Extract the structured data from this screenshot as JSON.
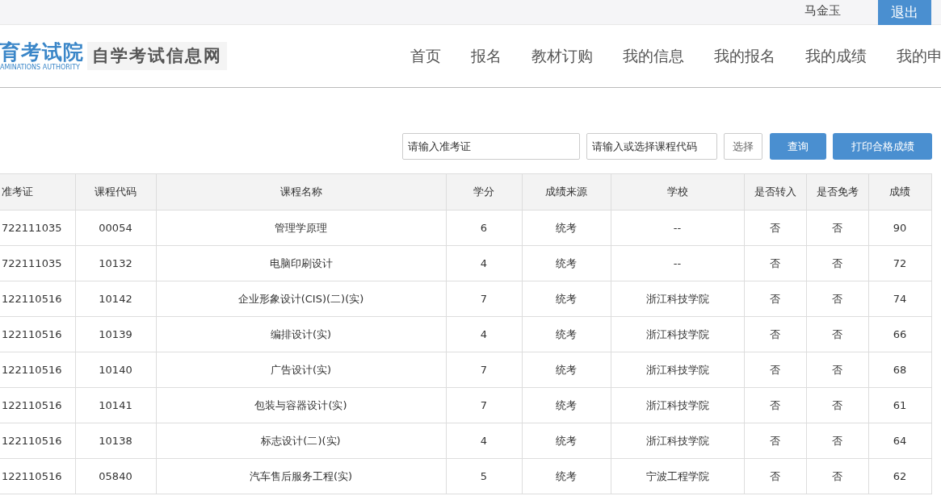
{
  "topbar": {
    "user": "马金玉",
    "logout": "退出"
  },
  "logo": {
    "title": "育考试院",
    "subtitle": "AMINATIONS AUTHORITY",
    "site": "自学考试信息网"
  },
  "nav": [
    "首页",
    "报名",
    "教材订购",
    "我的信息",
    "我的报名",
    "我的成绩",
    "我的申"
  ],
  "search": {
    "ticket_placeholder": "请输入准考证",
    "course_placeholder": "请输入或选择课程代码",
    "select": "选择",
    "query": "查询",
    "print": "打印合格成绩"
  },
  "table": {
    "columns": [
      "准考证",
      "课程代码",
      "课程名称",
      "学分",
      "成绩来源",
      "学校",
      "是否转入",
      "是否免考",
      "成绩"
    ],
    "rows": [
      [
        "722111035",
        "00054",
        "管理学原理",
        "6",
        "统考",
        "--",
        "否",
        "否",
        "90"
      ],
      [
        "722111035",
        "10132",
        "电脑印刷设计",
        "4",
        "统考",
        "--",
        "否",
        "否",
        "72"
      ],
      [
        "122110516",
        "10142",
        "企业形象设计(CIS)(二)(实)",
        "7",
        "统考",
        "浙江科技学院",
        "否",
        "否",
        "74"
      ],
      [
        "122110516",
        "10139",
        "编排设计(实)",
        "4",
        "统考",
        "浙江科技学院",
        "否",
        "否",
        "66"
      ],
      [
        "122110516",
        "10140",
        "广告设计(实)",
        "7",
        "统考",
        "浙江科技学院",
        "否",
        "否",
        "68"
      ],
      [
        "122110516",
        "10141",
        "包装与容器设计(实)",
        "7",
        "统考",
        "浙江科技学院",
        "否",
        "否",
        "61"
      ],
      [
        "122110516",
        "10138",
        "标志设计(二)(实)",
        "4",
        "统考",
        "浙江科技学院",
        "否",
        "否",
        "64"
      ],
      [
        "122110516",
        "05840",
        "汽车售后服务工程(实)",
        "5",
        "统考",
        "宁波工程学院",
        "否",
        "否",
        "62"
      ]
    ]
  }
}
